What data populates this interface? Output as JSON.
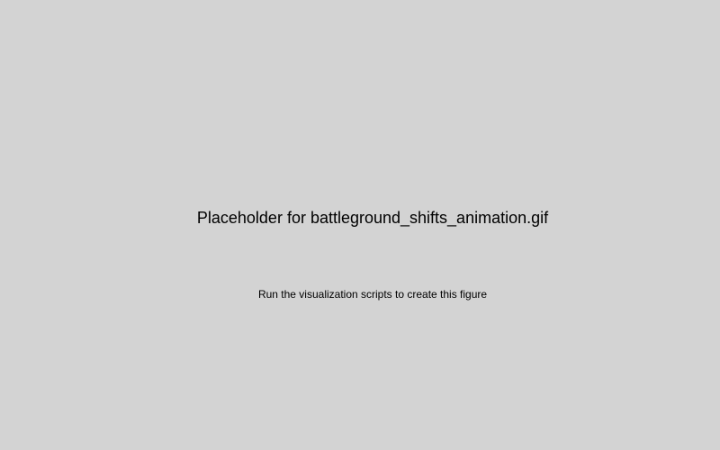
{
  "placeholder": {
    "title": "Placeholder for battleground_shifts_animation.gif",
    "subtitle": "Run the visualization scripts to create this figure"
  },
  "colors": {
    "background": "#d3d3d3",
    "text": "#000000"
  }
}
